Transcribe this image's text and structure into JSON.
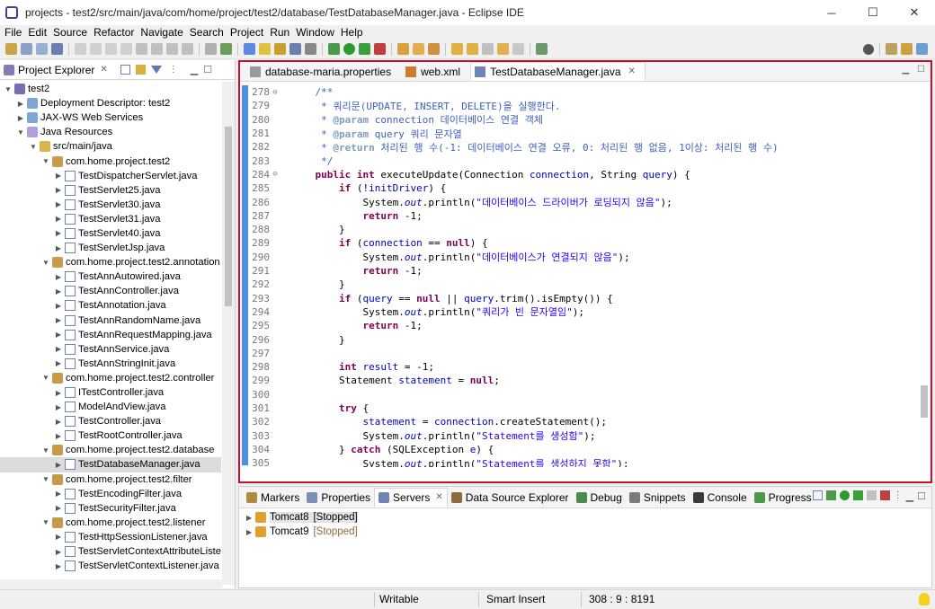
{
  "window": {
    "title": "projects - test2/src/main/java/com/home/project/test2/database/TestDatabaseManager.java - Eclipse IDE"
  },
  "window_buttons": {
    "minimize": "─",
    "maximize": "☐",
    "close": "✕"
  },
  "menu": [
    "File",
    "Edit",
    "Source",
    "Refactor",
    "Navigate",
    "Search",
    "Project",
    "Run",
    "Window",
    "Help"
  ],
  "project_explorer": {
    "tab_label": "Project Explorer",
    "tree": [
      {
        "label": "test2",
        "indent": 0,
        "icon": "proj",
        "arrow": "v"
      },
      {
        "label": "Deployment Descriptor: test2",
        "indent": 1,
        "icon": "web",
        "arrow": ">"
      },
      {
        "label": "JAX-WS Web Services",
        "indent": 1,
        "icon": "web",
        "arrow": ">"
      },
      {
        "label": "Java Resources",
        "indent": 1,
        "icon": "jres",
        "arrow": "v"
      },
      {
        "label": "src/main/java",
        "indent": 2,
        "icon": "src",
        "arrow": "v"
      },
      {
        "label": "com.home.project.test2",
        "indent": 3,
        "icon": "pkg",
        "arrow": "v"
      },
      {
        "label": "TestDispatcherServlet.java",
        "indent": 4,
        "icon": "java",
        "arrow": ">"
      },
      {
        "label": "TestServlet25.java",
        "indent": 4,
        "icon": "java",
        "arrow": ">"
      },
      {
        "label": "TestServlet30.java",
        "indent": 4,
        "icon": "java",
        "arrow": ">"
      },
      {
        "label": "TestServlet31.java",
        "indent": 4,
        "icon": "java",
        "arrow": ">"
      },
      {
        "label": "TestServlet40.java",
        "indent": 4,
        "icon": "java",
        "arrow": ">"
      },
      {
        "label": "TestServletJsp.java",
        "indent": 4,
        "icon": "java",
        "arrow": ">"
      },
      {
        "label": "com.home.project.test2.annotation",
        "indent": 3,
        "icon": "pkg",
        "arrow": "v"
      },
      {
        "label": "TestAnnAutowired.java",
        "indent": 4,
        "icon": "java",
        "arrow": ">"
      },
      {
        "label": "TestAnnController.java",
        "indent": 4,
        "icon": "java",
        "arrow": ">"
      },
      {
        "label": "TestAnnotation.java",
        "indent": 4,
        "icon": "java",
        "arrow": ">"
      },
      {
        "label": "TestAnnRandomName.java",
        "indent": 4,
        "icon": "java",
        "arrow": ">"
      },
      {
        "label": "TestAnnRequestMapping.java",
        "indent": 4,
        "icon": "java",
        "arrow": ">"
      },
      {
        "label": "TestAnnService.java",
        "indent": 4,
        "icon": "java",
        "arrow": ">"
      },
      {
        "label": "TestAnnStringInit.java",
        "indent": 4,
        "icon": "java",
        "arrow": ">"
      },
      {
        "label": "com.home.project.test2.controller",
        "indent": 3,
        "icon": "pkg",
        "arrow": "v"
      },
      {
        "label": "ITestController.java",
        "indent": 4,
        "icon": "java",
        "arrow": ">"
      },
      {
        "label": "ModelAndView.java",
        "indent": 4,
        "icon": "java",
        "arrow": ">"
      },
      {
        "label": "TestController.java",
        "indent": 4,
        "icon": "java",
        "arrow": ">"
      },
      {
        "label": "TestRootController.java",
        "indent": 4,
        "icon": "java",
        "arrow": ">"
      },
      {
        "label": "com.home.project.test2.database",
        "indent": 3,
        "icon": "pkg",
        "arrow": "v"
      },
      {
        "label": "TestDatabaseManager.java",
        "indent": 4,
        "icon": "java",
        "arrow": ">",
        "selected": true
      },
      {
        "label": "com.home.project.test2.filter",
        "indent": 3,
        "icon": "pkg",
        "arrow": "v"
      },
      {
        "label": "TestEncodingFilter.java",
        "indent": 4,
        "icon": "java",
        "arrow": ">"
      },
      {
        "label": "TestSecurityFilter.java",
        "indent": 4,
        "icon": "java",
        "arrow": ">"
      },
      {
        "label": "com.home.project.test2.listener",
        "indent": 3,
        "icon": "pkg",
        "arrow": "v"
      },
      {
        "label": "TestHttpSessionListener.java",
        "indent": 4,
        "icon": "java",
        "arrow": ">"
      },
      {
        "label": "TestServletContextAttributeListe",
        "indent": 4,
        "icon": "java",
        "arrow": ">"
      },
      {
        "label": "TestServletContextListener.java",
        "indent": 4,
        "icon": "java",
        "arrow": ">"
      }
    ]
  },
  "editor": {
    "tabs": [
      {
        "label": "database-maria.properties",
        "active": false
      },
      {
        "label": "web.xml",
        "active": false
      },
      {
        "label": "TestDatabaseManager.java",
        "active": true
      }
    ],
    "lines": [
      {
        "n": "278",
        "fold": "⊖",
        "html": "    <span class=\"cmt\">/**</span>"
      },
      {
        "n": "279",
        "fold": "",
        "html": "<span class=\"cmt\">     * 쿼리문(UPDATE, INSERT, DELETE)을 실행한다.</span>"
      },
      {
        "n": "280",
        "fold": "",
        "html": "<span class=\"cmt\">     * </span><span class=\"tag\">@param</span><span class=\"cmt\"> connection 데이터베이스 연결 객체</span>"
      },
      {
        "n": "281",
        "fold": "",
        "html": "<span class=\"cmt\">     * </span><span class=\"tag\">@param</span><span class=\"cmt\"> query 쿼리 문자열</span>"
      },
      {
        "n": "282",
        "fold": "",
        "html": "<span class=\"cmt\">     * </span><span class=\"tag\">@return</span><span class=\"cmt\"> 처리된 행 수(-1: 데이터베이스 연결 오류, 0: 처리된 행 없음, 1이상: 처리된 행 수)</span>"
      },
      {
        "n": "283",
        "fold": "",
        "html": "<span class=\"cmt\">     */</span>"
      },
      {
        "n": "284",
        "fold": "⊖",
        "html": "    <span class=\"kw\">public</span> <span class=\"kw\">int</span> executeUpdate(Connection <span class=\"var\">connection</span>, String <span class=\"var\">query</span>) {"
      },
      {
        "n": "285",
        "fold": "",
        "html": "        <span class=\"kw\">if</span> (!<span class=\"var\">initDriver</span>) {"
      },
      {
        "n": "286",
        "fold": "",
        "html": "            System.<span class=\"sta\">out</span>.println(<span class=\"str\">\"데이터베이스 드라이버가 로딩되지 않음\"</span>);"
      },
      {
        "n": "287",
        "fold": "",
        "html": "            <span class=\"kw\">return</span> -1;"
      },
      {
        "n": "288",
        "fold": "",
        "html": "        }"
      },
      {
        "n": "289",
        "fold": "",
        "html": "        <span class=\"kw\">if</span> (<span class=\"var\">connection</span> == <span class=\"kw\">null</span>) {"
      },
      {
        "n": "290",
        "fold": "",
        "html": "            System.<span class=\"sta\">out</span>.println(<span class=\"str\">\"데이터베이스가 연결되지 않음\"</span>);"
      },
      {
        "n": "291",
        "fold": "",
        "html": "            <span class=\"kw\">return</span> -1;"
      },
      {
        "n": "292",
        "fold": "",
        "html": "        }"
      },
      {
        "n": "293",
        "fold": "",
        "html": "        <span class=\"kw\">if</span> (<span class=\"var\">query</span> == <span class=\"kw\">null</span> || <span class=\"var\">query</span>.trim().isEmpty()) {"
      },
      {
        "n": "294",
        "fold": "",
        "html": "            System.<span class=\"sta\">out</span>.println(<span class=\"str\">\"쿼리가 빈 문자열임\"</span>);"
      },
      {
        "n": "295",
        "fold": "",
        "html": "            <span class=\"kw\">return</span> -1;"
      },
      {
        "n": "296",
        "fold": "",
        "html": "        }"
      },
      {
        "n": "297",
        "fold": "",
        "html": ""
      },
      {
        "n": "298",
        "fold": "",
        "html": "        <span class=\"kw\">int</span> <span class=\"var\">result</span> = -1;"
      },
      {
        "n": "299",
        "fold": "",
        "html": "        Statement <span class=\"var\">statement</span> = <span class=\"kw\">null</span>;"
      },
      {
        "n": "300",
        "fold": "",
        "html": ""
      },
      {
        "n": "301",
        "fold": "",
        "html": "        <span class=\"kw\">try</span> {"
      },
      {
        "n": "302",
        "fold": "",
        "html": "            <span class=\"var\">statement</span> = <span class=\"var\">connection</span>.createStatement();"
      },
      {
        "n": "303",
        "fold": "",
        "html": "            System.<span class=\"sta\">out</span>.println(<span class=\"str\">\"Statement를 생성함\"</span>);"
      },
      {
        "n": "304",
        "fold": "",
        "html": "        } <span class=\"kw\">catch</span> (SQLException <span class=\"var\">e</span>) {"
      },
      {
        "n": "305",
        "fold": "",
        "html": "            System.<span class=\"sta\">out</span>.println(<span class=\"str\">\"Statement를 생성하지 못함\"</span>);"
      }
    ]
  },
  "bottom_panel": {
    "tabs": [
      {
        "label": "Markers",
        "color": "#b08a3a"
      },
      {
        "label": "Properties",
        "color": "#7a8fb5"
      },
      {
        "label": "Servers",
        "color": "#6d84b4",
        "active": true
      },
      {
        "label": "Data Source Explorer",
        "color": "#8a6d3b"
      },
      {
        "label": "Debug",
        "color": "#4a8a4a"
      },
      {
        "label": "Snippets",
        "color": "#7a7a7a"
      },
      {
        "label": "Console",
        "color": "#3a3a3a"
      },
      {
        "label": "Progress",
        "color": "#4a9a4a"
      }
    ],
    "servers": [
      {
        "name": "Tomcat8",
        "state": "[Stopped]",
        "selected": true
      },
      {
        "name": "Tomcat9",
        "state": "[Stopped]",
        "selected": false
      }
    ]
  },
  "status": {
    "writable": "Writable",
    "insert_mode": "Smart Insert",
    "position": "308 : 9 : 8191"
  },
  "colors": {
    "editor_focus_border": "#c8102e",
    "keyword": "#7f0055",
    "string": "#2a00ff",
    "comment": "#3f5fbf"
  }
}
